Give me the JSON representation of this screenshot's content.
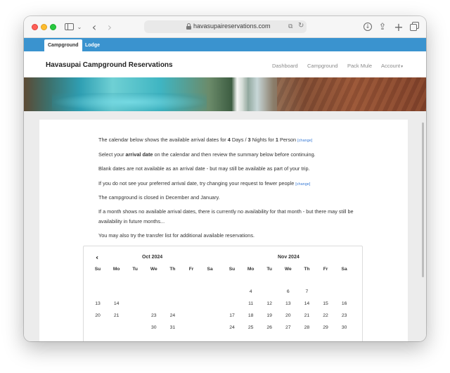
{
  "browser": {
    "url": "havasupaireservations.com"
  },
  "site": {
    "tabs": [
      {
        "label": "Campground",
        "active": true
      },
      {
        "label": "Lodge",
        "active": false
      }
    ],
    "title": "Havasupai Campground Reservations",
    "nav": {
      "dashboard": "Dashboard",
      "campground": "Campground",
      "pack_mule": "Pack Mule",
      "account": "Account"
    }
  },
  "content": {
    "line1": {
      "prefix": "The calendar below shows the available arrival dates for ",
      "days_num": "4",
      "days_word": " Days / ",
      "nights_num": "3",
      "nights_word": " Nights for ",
      "persons_num": "1",
      "persons_word": " Person ",
      "change": "[change]"
    },
    "line2": {
      "prefix": "Select your ",
      "bold": "arrival date",
      "suffix": " on the calendar and then review the summary below before continuing."
    },
    "line3": "Blank dates are not available as an arrival date - but may still be available as part of your trip.",
    "line4": {
      "text": "If you do not see your preferred arrival date, try changing your request to fewer people ",
      "change": "[change]"
    },
    "line5": "The campground is closed in December and January.",
    "line6a": "If a month shows no available arrival dates, there is currently no availability for that month - but there may still be",
    "line6b": "availability in future months...",
    "line7": "You may also try the transfer list for additional available reservations."
  },
  "calendar": {
    "prev": "‹",
    "weekdays": [
      "Su",
      "Mo",
      "Tu",
      "We",
      "Th",
      "Fr",
      "Sa"
    ],
    "months": [
      {
        "title": "Oct 2024",
        "weeks": [
          [
            "",
            "",
            "",
            "",
            "",
            "",
            ""
          ],
          [
            "13",
            "14",
            "",
            "",
            "",
            "",
            ""
          ],
          [
            "20",
            "21",
            "",
            "23",
            "24",
            "",
            ""
          ],
          [
            "",
            "",
            "",
            "30",
            "31",
            "",
            ""
          ]
        ]
      },
      {
        "title": "Nov 2024",
        "weeks": [
          [
            "",
            "4",
            "",
            "6",
            "7",
            "",
            ""
          ],
          [
            "",
            "11",
            "12",
            "13",
            "14",
            "15",
            "16"
          ],
          [
            "17",
            "18",
            "19",
            "20",
            "21",
            "22",
            "23"
          ],
          [
            "24",
            "25",
            "26",
            "27",
            "28",
            "29",
            "30"
          ]
        ]
      }
    ]
  }
}
